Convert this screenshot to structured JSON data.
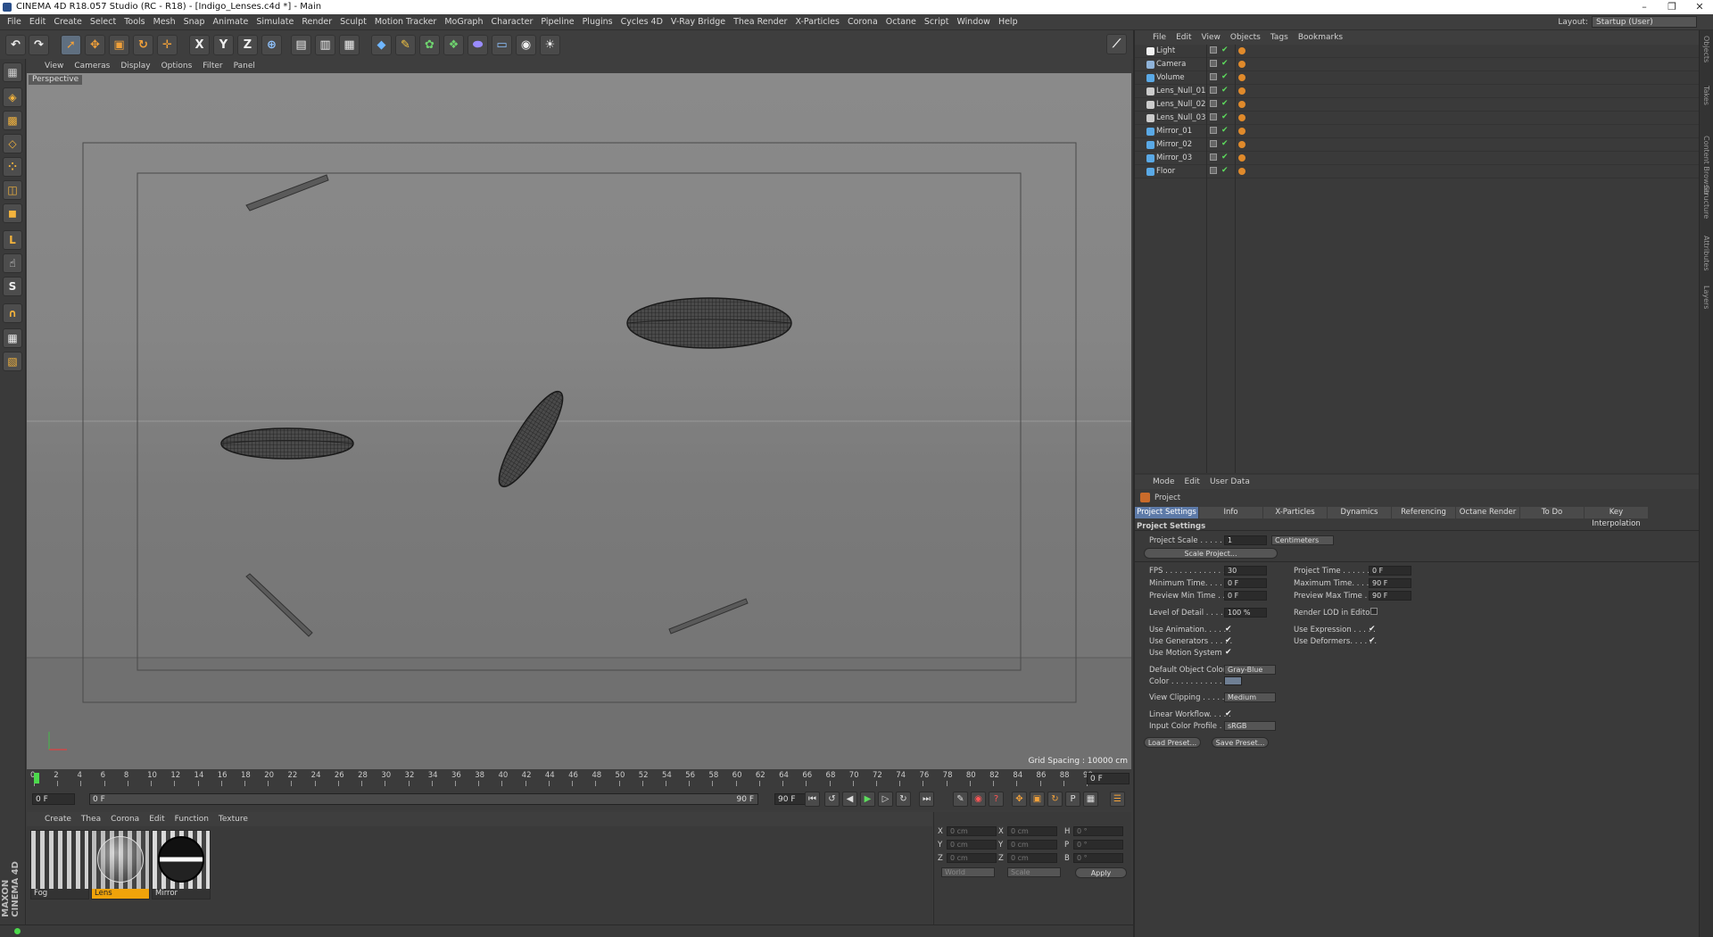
{
  "window": {
    "title": "CINEMA 4D R18.057 Studio (RC - R18) - [Indigo_Lenses.c4d *] - Main"
  },
  "menu": [
    "File",
    "Edit",
    "Create",
    "Select",
    "Tools",
    "Mesh",
    "Snap",
    "Animate",
    "Simulate",
    "Render",
    "Sculpt",
    "Motion Tracker",
    "MoGraph",
    "Character",
    "Pipeline",
    "Plugins",
    "Cycles 4D",
    "V-Ray Bridge",
    "Thea Render",
    "X-Particles",
    "Corona",
    "Octane",
    "Script",
    "Window",
    "Help"
  ],
  "layout": {
    "label": "Layout:",
    "value": "Startup (User)"
  },
  "toolbar": {
    "axis_x": "X",
    "axis_y": "Y",
    "axis_z": "Z"
  },
  "viewport": {
    "menu": [
      "View",
      "Cameras",
      "Display",
      "Options",
      "Filter",
      "Panel"
    ],
    "camera_label": "Perspective",
    "grid_spacing": "Grid Spacing : 10000 cm"
  },
  "timeline": {
    "ticks": [
      "0",
      "2",
      "4",
      "6",
      "8",
      "10",
      "12",
      "14",
      "16",
      "18",
      "20",
      "22",
      "24",
      "26",
      "28",
      "30",
      "32",
      "34",
      "36",
      "38",
      "40",
      "42",
      "44",
      "46",
      "48",
      "50",
      "52",
      "54",
      "56",
      "58",
      "60",
      "62",
      "64",
      "66",
      "68",
      "70",
      "72",
      "74",
      "76",
      "78",
      "80",
      "82",
      "84",
      "86",
      "88",
      "90"
    ],
    "current_frame": "0 F",
    "start_field": "0 F",
    "range_start": "0 F",
    "range_end": "90 F",
    "end_field": "90 F"
  },
  "materials": {
    "menu": [
      "Create",
      "Thea",
      "Corona",
      "Edit",
      "Function",
      "Texture"
    ],
    "items": [
      {
        "name": "Fog",
        "selected": false
      },
      {
        "name": "Lens",
        "selected": true
      },
      {
        "name": "Mirror",
        "selected": false
      }
    ]
  },
  "coordinates": {
    "rows": [
      {
        "a": "X",
        "av": "0 cm",
        "b": "X",
        "bv": "0 cm",
        "c": "H",
        "cv": "0 °"
      },
      {
        "a": "Y",
        "av": "0 cm",
        "b": "Y",
        "bv": "0 cm",
        "c": "P",
        "cv": "0 °"
      },
      {
        "a": "Z",
        "av": "0 cm",
        "b": "Z",
        "bv": "0 cm",
        "c": "B",
        "cv": "0 °"
      }
    ],
    "world": "World",
    "scale": "Scale",
    "apply": "Apply"
  },
  "objects": {
    "menu": [
      "File",
      "Edit",
      "View",
      "Objects",
      "Tags",
      "Bookmarks"
    ],
    "items": [
      {
        "name": "Light",
        "color": "#f2f2f2"
      },
      {
        "name": "Camera",
        "color": "#8fb3d9"
      },
      {
        "name": "Volume",
        "color": "#5aa9e6"
      },
      {
        "name": "Lens_Null_01",
        "color": "#cccccc"
      },
      {
        "name": "Lens_Null_02",
        "color": "#cccccc"
      },
      {
        "name": "Lens_Null_03",
        "color": "#cccccc"
      },
      {
        "name": "Mirror_01",
        "color": "#5aa9e6"
      },
      {
        "name": "Mirror_02",
        "color": "#5aa9e6"
      },
      {
        "name": "Mirror_03",
        "color": "#5aa9e6"
      },
      {
        "name": "Floor",
        "color": "#5aa9e6"
      }
    ]
  },
  "attributes": {
    "menu": [
      "Mode",
      "Edit",
      "User Data"
    ],
    "header": "Project",
    "tabs": [
      "Project Settings",
      "Info",
      "X-Particles",
      "Dynamics",
      "Referencing",
      "Octane Render",
      "To Do",
      "Key Interpolation"
    ],
    "section": "Project Settings",
    "project_scale_label": "Project Scale . . . . .",
    "project_scale_value": "1",
    "project_scale_unit": "Centimeters",
    "scale_project_btn": "Scale Project...",
    "fps_label": "FPS . . . . . . . . . . . . . .",
    "fps": "30",
    "project_time_label": "Project Time . . . . . . .",
    "project_time": "0 F",
    "min_time_label": "Minimum Time. . . . . .",
    "min_time": "0 F",
    "max_time_label": "Maximum Time. . . . . .",
    "max_time": "90 F",
    "prev_min_label": "Preview Min Time . . .",
    "prev_min": "0 F",
    "prev_max_label": "Preview Max Time . . .",
    "prev_max": "90 F",
    "lod_label": "Level of Detail . . . . .",
    "lod": "100 %",
    "render_lod_label": "Render LOD in Editor",
    "use_animation": "Use Animation. . . . . .",
    "use_expression": "Use Expression . . . . .",
    "use_generators": "Use Generators . . . . .",
    "use_deformers": "Use Deformers. . . . . .",
    "use_motion": "Use Motion System",
    "def_obj_color_label": "Default Object Color",
    "def_obj_color": "Gray-Blue",
    "color_label": "Color . . . . . . . . . . . .",
    "view_clipping_label": "View Clipping . . . . . .",
    "view_clipping": "Medium",
    "linear_workflow": "Linear Workflow. . . . .",
    "input_profile_label": "Input Color Profile . .",
    "input_profile": "sRGB",
    "load_preset": "Load Preset...",
    "save_preset": "Save Preset..."
  },
  "siderail": [
    "Objects",
    "Takes",
    "Content Browser",
    "Structure",
    "Attributes",
    "Layers"
  ]
}
